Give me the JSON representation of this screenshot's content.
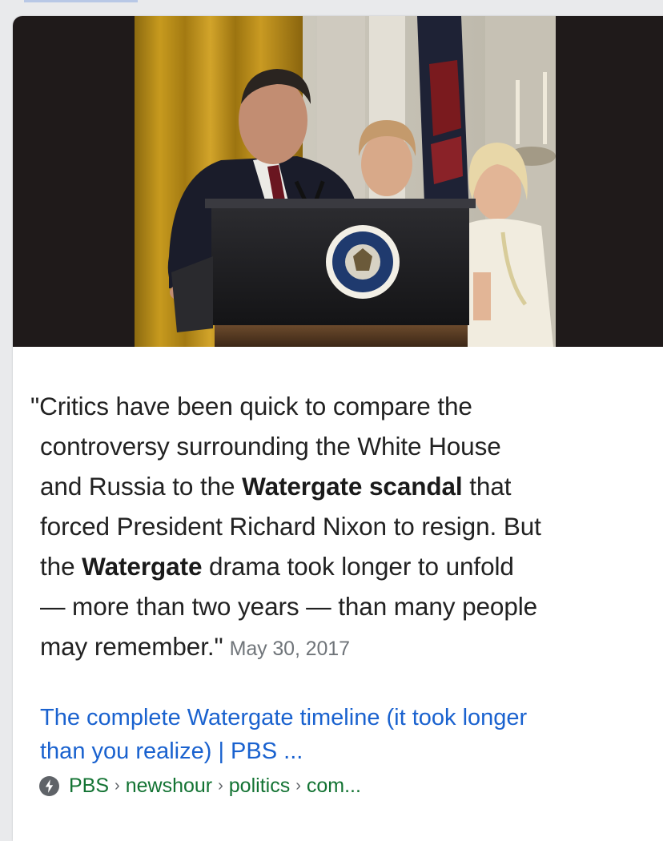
{
  "snippet": {
    "l1": "\"Critics have been quick to compare the",
    "l2": "controversy surrounding the White House",
    "l3_pre": "and Russia to the ",
    "l3_bold": "Watergate scandal",
    "l3_post": " that",
    "l4": "forced President Richard Nixon to resign. But",
    "l5_pre": "the ",
    "l5_bold": "Watergate",
    "l5_post": " drama took longer to unfold",
    "l6": "— more than two years — than many people",
    "l7": "may remember.\"",
    "date": "May 30, 2017"
  },
  "result": {
    "title_line1": "The complete Watergate timeline (it took longer",
    "title_line2": "than you realize) | PBS ..."
  },
  "breadcrumb": {
    "icon": "amp-lightning-icon",
    "parts": [
      "PBS",
      "newshour",
      "politics",
      "com..."
    ],
    "separator": "›"
  },
  "colors": {
    "link": "#1a62cf",
    "url_green": "#137333",
    "date_gray": "#70757a"
  }
}
